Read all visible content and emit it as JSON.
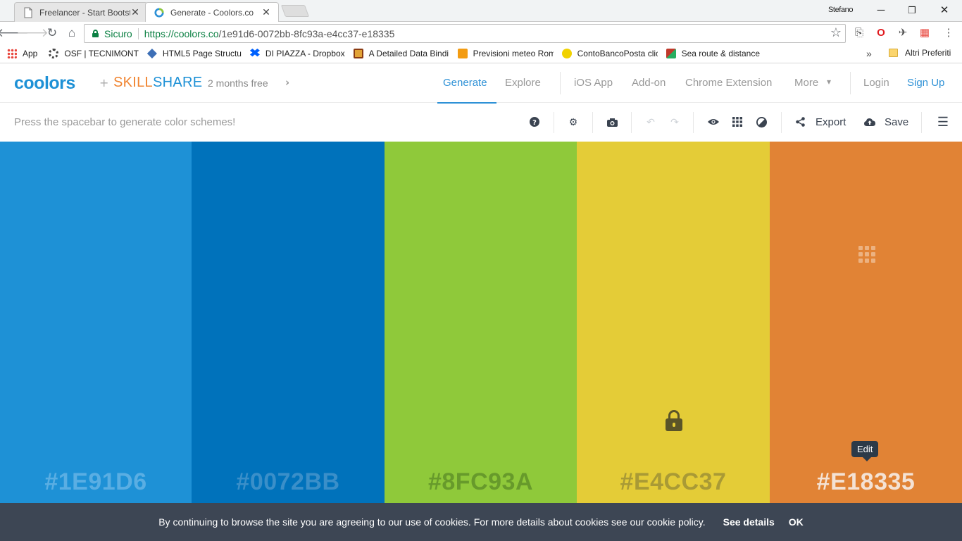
{
  "browser": {
    "tabs": [
      {
        "title": "Freelancer - Start Bootstr",
        "active": false,
        "icon": "page-icon"
      },
      {
        "title": "Generate - Coolors.co",
        "active": true,
        "icon": "coolors-favicon"
      }
    ],
    "profile_name": "Stefano",
    "window_controls": {
      "minimize": "─",
      "maximize": "❐",
      "close": "✕"
    },
    "address": {
      "secure_label": "Sicuro",
      "url_host": "https://coolors.co",
      "url_path": "/1e91d6-0072bb-8fc93a-e4cc37-e18335"
    },
    "bookmarks": [
      {
        "label": "App",
        "icon": "apps-grid-icon",
        "color": "#e8453c"
      },
      {
        "label": "OSF | TECNIMONT",
        "icon": "osf-icon",
        "color": "#444444"
      },
      {
        "label": "HTML5 Page Structur",
        "icon": "html5-icon",
        "color": "#3d6fb6"
      },
      {
        "label": "DI PIAZZA - Dropbox",
        "icon": "dropbox-icon",
        "color": "#0061fe"
      },
      {
        "label": "A Detailed Data Bindi",
        "icon": "binding-icon",
        "color": "#c0392b"
      },
      {
        "label": "Previsioni meteo Rom",
        "icon": "meteo-icon",
        "color": "#f39c12"
      },
      {
        "label": "ContoBancoPosta clic",
        "icon": "poste-icon",
        "color": "#f1c40f"
      },
      {
        "label": "Sea route & distance",
        "icon": "sea-route-icon",
        "color": "#c0392b"
      }
    ],
    "bookmarks_overflow": "»",
    "other_bookmarks": "Altri Preferiti"
  },
  "site": {
    "logo": "coolors",
    "plus": "+",
    "partner_part1": "SKILL",
    "partner_part2": "SHARE",
    "promo": "2 months free",
    "nav": {
      "generate": "Generate",
      "explore": "Explore",
      "ios": "iOS App",
      "addon": "Add-on",
      "chrome": "Chrome Extension",
      "more": "More",
      "login": "Login",
      "signup": "Sign Up"
    },
    "colors": {
      "brand_blue": "#2e91d6",
      "skill_orange": "#f08430"
    }
  },
  "toolbar": {
    "hint": "Press the spacebar to generate color schemes!",
    "export": "Export",
    "save": "Save"
  },
  "palette": [
    {
      "hex": "#1E91D6",
      "color": "#1e91d6",
      "text_color": "#5aaee3",
      "locked": false
    },
    {
      "hex": "#0072BB",
      "color": "#0072bb",
      "text_color": "#3a8fc9",
      "locked": false
    },
    {
      "hex": "#8FC93A",
      "color": "#8fc93a",
      "text_color": "#679a2b",
      "locked": false
    },
    {
      "hex": "#E4CC37",
      "color": "#e4cc37",
      "text_color": "#a99a35",
      "locked": true
    },
    {
      "hex": "#E18335",
      "color": "#e18335",
      "text_color": "#f4e2d4",
      "locked": false,
      "hovered": true
    }
  ],
  "tooltip": {
    "edit": "Edit"
  },
  "cookie": {
    "text": "By continuing to browse the site you are agreeing to our use of cookies. For more details about cookies see our cookie policy.",
    "details": "See details",
    "ok": "OK"
  }
}
